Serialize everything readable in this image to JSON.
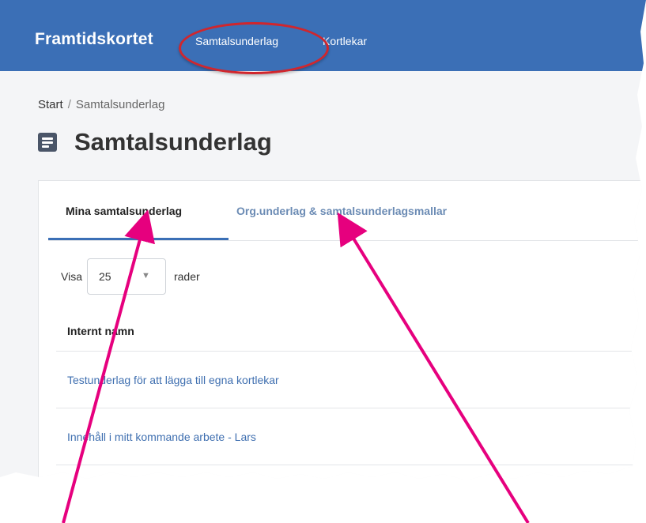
{
  "navbar": {
    "brand": "Framtidskortet",
    "items": [
      {
        "label": "Samtalsunderlag"
      },
      {
        "label": "Kortlekar"
      }
    ]
  },
  "breadcrumb": {
    "home": "Start",
    "separator": "/",
    "current": "Samtalsunderlag"
  },
  "page": {
    "title": "Samtalsunderlag",
    "icon": "document-icon"
  },
  "tabs": [
    {
      "label": "Mina samtalsunderlag",
      "active": true
    },
    {
      "label": "Org.underlag & samtalsunderlagsmallar",
      "active": false
    }
  ],
  "length_menu": {
    "prefix": "Visa",
    "value": "25",
    "suffix": "rader"
  },
  "table": {
    "columns": [
      "Internt namn"
    ],
    "rows": [
      {
        "name": "Testunderlag för att lägga till egna kortlekar"
      },
      {
        "name": "Innehåll i mitt kommande arbete - Lars"
      }
    ]
  },
  "colors": {
    "navbar": "#3b6fb6",
    "link": "#3f6fb0",
    "highlight_ellipse": "#d0262d",
    "annotation_arrow": "#e6007e"
  }
}
